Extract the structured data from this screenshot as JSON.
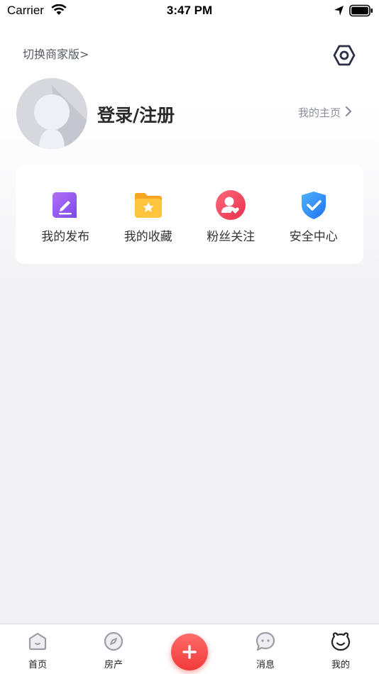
{
  "status_bar": {
    "carrier": "Carrier",
    "time": "3:47 PM"
  },
  "header": {
    "switch_merchant": "切换商家版>",
    "settings_icon": "hexagon-gear-icon"
  },
  "profile": {
    "avatar_icon": "default-avatar-icon",
    "login_label": "登录/注册",
    "homepage_label": "我的主页"
  },
  "quick_actions": [
    {
      "label": "我的发布",
      "icon": "edit-note-icon",
      "color": "#8e5bf0"
    },
    {
      "label": "我的收藏",
      "icon": "star-folder-icon",
      "color": "#ffc53d"
    },
    {
      "label": "粉丝关注",
      "icon": "user-heart-icon",
      "color": "#f0435c"
    },
    {
      "label": "安全中心",
      "icon": "shield-check-icon",
      "color": "#2f8cf5"
    }
  ],
  "tab_bar": {
    "items": [
      {
        "label": "首页",
        "icon": "home-icon"
      },
      {
        "label": "房产",
        "icon": "compass-icon"
      },
      {
        "label": "消息",
        "icon": "chat-bubble-icon"
      },
      {
        "label": "我的",
        "icon": "face-icon"
      }
    ],
    "publish_icon": "plus-icon",
    "accent": "#f23a3a"
  }
}
